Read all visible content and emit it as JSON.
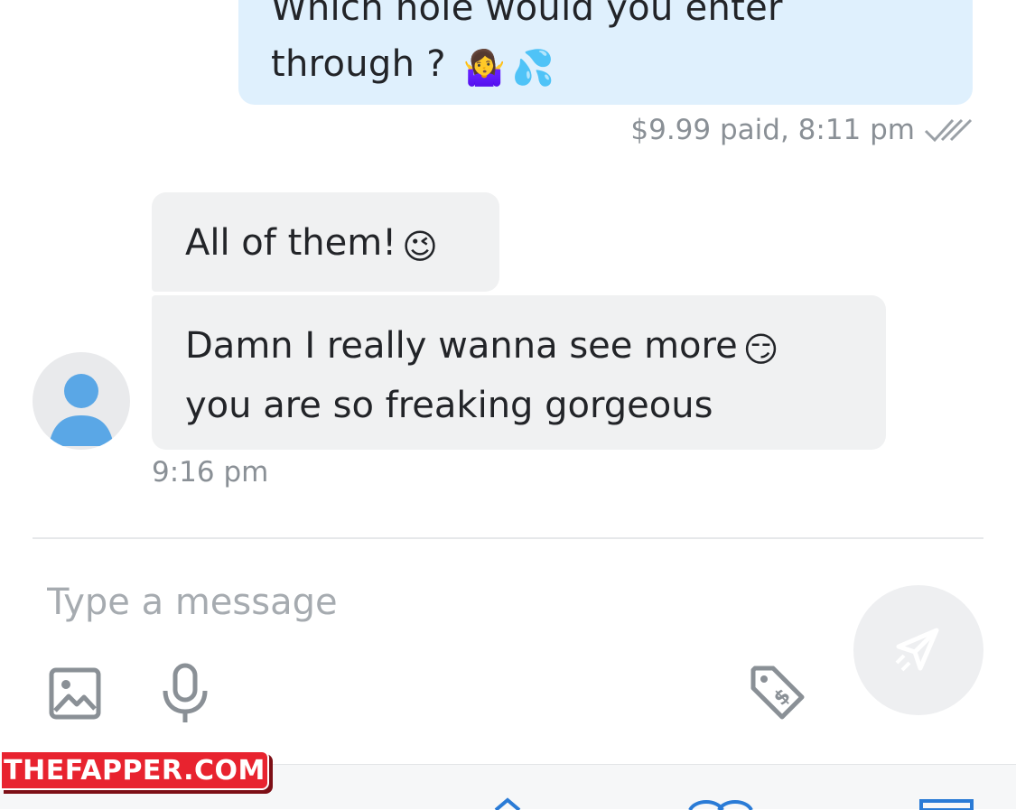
{
  "outgoing": {
    "text": "Which hole would you enter through ?",
    "emoji_1": "🤷‍♀️",
    "emoji_2": "💦",
    "meta": "$9.99 paid, 8:11 pm",
    "status_icon": "double-check-icon"
  },
  "incoming": {
    "message_1": {
      "text": "All of them!",
      "emoji": "😉"
    },
    "message_2": {
      "text": "Damn I really wanna see more",
      "emoji": "😏",
      "text_2": "you are so freaking gorgeous"
    },
    "time": "9:16 pm"
  },
  "composer": {
    "placeholder": "Type a message",
    "value": ""
  },
  "watermark": "THEFAPPER.COM",
  "colors": {
    "outgoing_bubble": "#dff0fd",
    "incoming_bubble": "#f0f1f2",
    "meta_text": "#8a9096",
    "icon_gray": "#8a9096",
    "send_button": "#eeeff1",
    "avatar_blue": "#5aa7e6",
    "watermark_red": "#e8232f"
  }
}
